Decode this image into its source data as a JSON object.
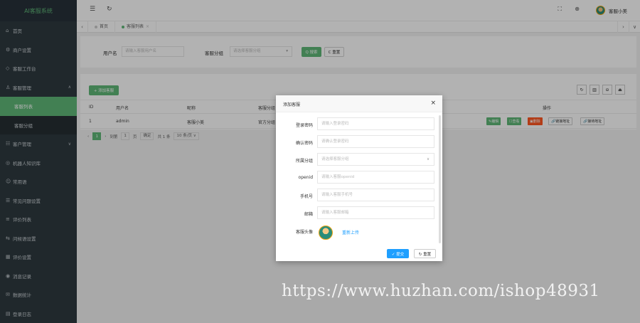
{
  "app": {
    "brand": "AI客服系统"
  },
  "sidebar": {
    "items": [
      {
        "icon": "home-icon",
        "glyph": "⌂",
        "label": "首页"
      },
      {
        "icon": "gear-icon",
        "glyph": "⚙",
        "label": "商户设置"
      },
      {
        "icon": "workbench-icon",
        "glyph": "◇",
        "label": "客服工作台"
      },
      {
        "icon": "user-icon",
        "glyph": "♙",
        "label": "客服管理",
        "arrow": "∧"
      },
      {
        "icon": "customer-icon",
        "glyph": "☷",
        "label": "客户管理",
        "arrow": "∨"
      },
      {
        "icon": "robot-icon",
        "glyph": "◎",
        "label": "机器人知识库"
      },
      {
        "icon": "smile-icon",
        "glyph": "☺",
        "label": "常用语"
      },
      {
        "icon": "question-icon",
        "glyph": "☰",
        "label": "常见问题设置"
      },
      {
        "icon": "list-icon",
        "glyph": "≡",
        "label": "评价列表"
      },
      {
        "icon": "link-icon",
        "glyph": "⇆",
        "label": "问候语设置"
      },
      {
        "icon": "grid-icon",
        "glyph": "▦",
        "label": "评价设置"
      },
      {
        "icon": "record-icon",
        "glyph": "◉",
        "label": "消息记录"
      },
      {
        "icon": "stats-icon",
        "glyph": "✉",
        "label": "数据统计"
      },
      {
        "icon": "log-icon",
        "glyph": "▤",
        "label": "登录日志"
      }
    ],
    "sub_items": [
      "客服列表",
      "客服分组"
    ]
  },
  "header": {
    "menu_glyph": "☰",
    "refresh_glyph": "↻",
    "fullscreen_glyph": "⛶",
    "theme_glyph": "⊕",
    "username": "客服小美"
  },
  "tabs": {
    "prev": "‹",
    "items": [
      {
        "label": "首页",
        "closable": false
      },
      {
        "label": "客服列表",
        "closable": true,
        "close": "×"
      }
    ],
    "next": "›",
    "more": "∨"
  },
  "search": {
    "username_label": "用户名",
    "username_placeholder": "请输入客服用户名",
    "group_label": "客服分组",
    "group_placeholder": "请选择客服分组",
    "search_button": "Q 搜索",
    "reset_button": "C 重置"
  },
  "table": {
    "add_button": "+ 添加客服",
    "tools": [
      "↻",
      "▥",
      "⊖",
      "⏏"
    ],
    "headers": {
      "id": "ID",
      "username": "用户名",
      "nickname": "昵称",
      "group": "客服分组",
      "actions": "操作"
    },
    "rows": [
      {
        "id": "1",
        "username": "admin",
        "nickname": "客服小美",
        "group": "官方分组"
      }
    ],
    "row_actions": {
      "edit": "✎编辑",
      "view": "☐查看",
      "delete": "▣删除",
      "link1": "🔗链接地址",
      "link2": "🔗接待地址"
    }
  },
  "pager": {
    "prev": "‹",
    "current": "1",
    "next": "›",
    "goto_label": "到第",
    "goto_value": "1",
    "page_unit": "页",
    "confirm": "确定",
    "total": "共 1 条",
    "per_page": "10 条/页 ∨"
  },
  "modal": {
    "title": "添加客服",
    "close": "×",
    "fields": [
      {
        "label": "登录密码",
        "placeholder": "请输入登录密码"
      },
      {
        "label": "确认密码",
        "placeholder": "请确认登录密码"
      },
      {
        "label": "所属分组",
        "placeholder": "请选择客服分组",
        "select": true,
        "caret": "∨"
      },
      {
        "label": "openid",
        "placeholder": "请输入客服openid"
      },
      {
        "label": "手机号",
        "placeholder": "请输入客服手机号"
      },
      {
        "label": "邮箱",
        "placeholder": "请输入客服邮箱"
      }
    ],
    "avatar_label": "客服头像",
    "upload_text": "重新上传",
    "submit": "✓ 提交",
    "reset": "↻ 重置"
  },
  "watermark": "https://www.huzhan.com/ishop48931"
}
